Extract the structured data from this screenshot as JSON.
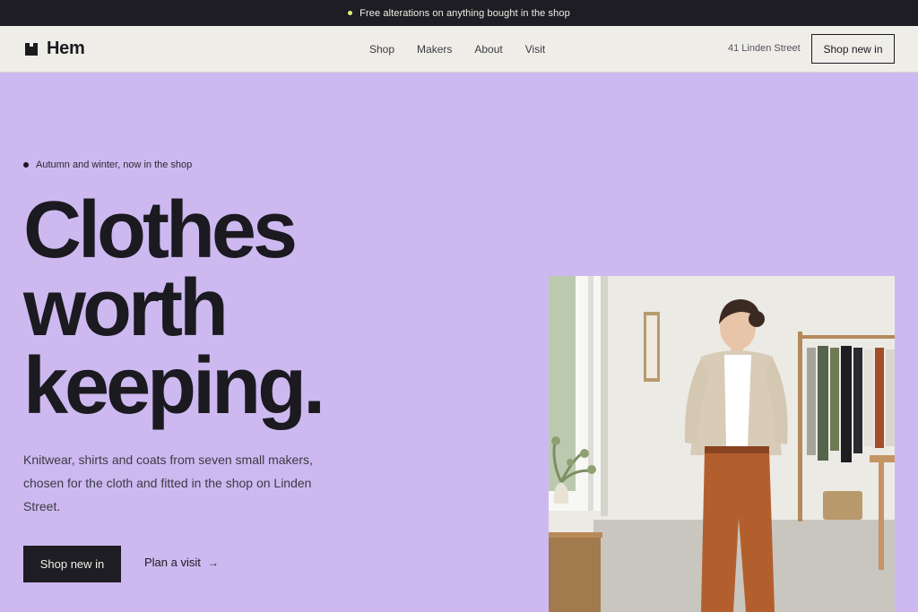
{
  "announcement": {
    "text": "Free alterations on anything bought in the shop",
    "dot_color": "#e6ef7c"
  },
  "header": {
    "logo_text": "Hem",
    "nav": [
      "Shop",
      "Makers",
      "About",
      "Visit"
    ],
    "address": "41 Linden Street",
    "cta_label": "Shop new in"
  },
  "hero": {
    "eyebrow": "Autumn and winter, now in the shop",
    "headline_lines": [
      "Clothes",
      "worth",
      "keeping."
    ],
    "description": "Knitwear, shirts and coats from seven small makers, chosen for the cloth and fitted in the shop on Linden Street.",
    "primary_button": "Shop new in",
    "secondary_link": "Plan a visit",
    "secondary_link_icon": "arrow-right-icon",
    "background_color": "#cdb9f0"
  },
  "colors": {
    "ink": "#1b1a20",
    "bar": "#1e1d23",
    "nav_bg": "#efede8",
    "accent": "#cdb9f0"
  }
}
